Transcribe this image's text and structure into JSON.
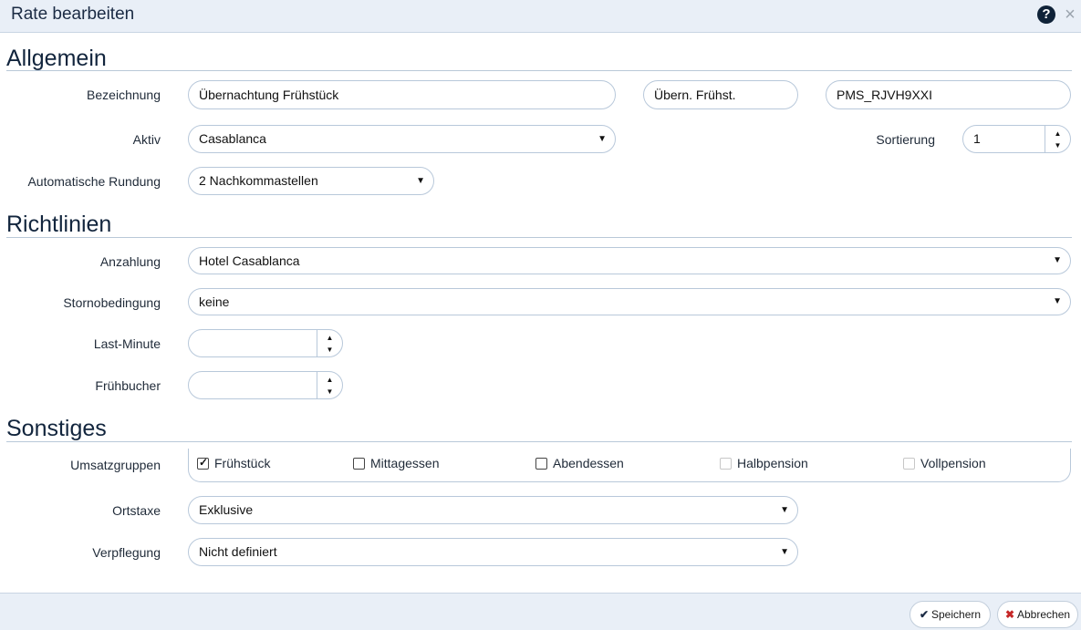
{
  "dialog": {
    "title": "Rate bearbeiten",
    "help_icon": "?",
    "close_icon": "×"
  },
  "sections": {
    "allgemein": "Allgemein",
    "richtlinien": "Richtlinien",
    "sonstiges": "Sonstiges"
  },
  "allgemein": {
    "bezeichnung_label": "Bezeichnung",
    "bezeichnung_value": "Übernachtung Frühstück",
    "kurzname_value": "Übern. Frühst.",
    "code_value": "PMS_RJVH9XXI",
    "aktiv_label": "Aktiv",
    "aktiv_value": "Casablanca",
    "sortierung_label": "Sortierung",
    "sortierung_value": "1",
    "rundung_label": "Automatische Rundung",
    "rundung_value": "2 Nachkommastellen"
  },
  "richtlinien": {
    "anzahlung_label": "Anzahlung",
    "anzahlung_value": "Hotel Casablanca",
    "storno_label": "Stornobedingung",
    "storno_value": "keine",
    "lastminute_label": "Last-Minute",
    "lastminute_value": "",
    "fruehbucher_label": "Frühbucher",
    "fruehbucher_value": ""
  },
  "sonstiges": {
    "umsatzgruppen_label": "Umsatzgruppen",
    "umsatzgruppen": [
      {
        "label": "Frühstück",
        "checked": true,
        "disabled": false
      },
      {
        "label": "Mittagessen",
        "checked": false,
        "disabled": false
      },
      {
        "label": "Abendessen",
        "checked": false,
        "disabled": false
      },
      {
        "label": "Halbpension",
        "checked": false,
        "disabled": true
      },
      {
        "label": "Vollpension",
        "checked": false,
        "disabled": true
      }
    ],
    "ortstaxe_label": "Ortstaxe",
    "ortstaxe_value": "Exklusive",
    "verpflegung_label": "Verpflegung",
    "verpflegung_value": "Nicht definiert"
  },
  "footer": {
    "save_label": "Speichern",
    "cancel_label": "Abbrechen"
  },
  "icons": {
    "caret": "▼",
    "spin_up": "▲",
    "spin_down": "▼",
    "save": "✔",
    "cancel": "✖"
  },
  "colors": {
    "header_bg": "#e9eff7",
    "heading": "#12253d",
    "border": "#b8c8da",
    "cancel_icon": "#c62828"
  }
}
